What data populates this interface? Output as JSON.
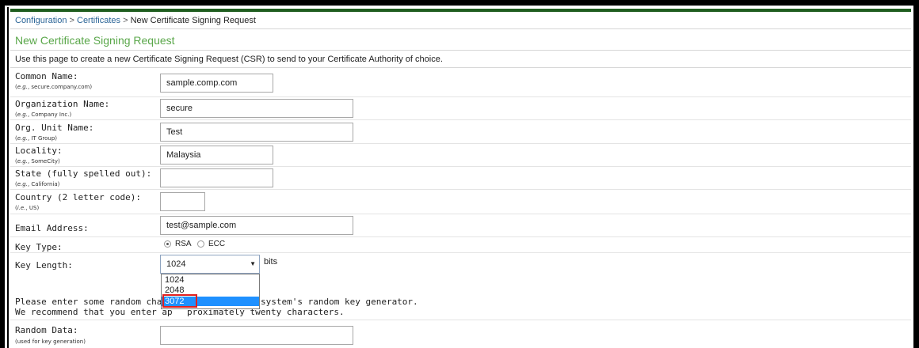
{
  "breadcrumb": {
    "items": [
      "Configuration",
      "Certificates"
    ],
    "separator": ">",
    "current": "New Certificate Signing Request"
  },
  "page": {
    "title": "New Certificate Signing Request",
    "description": "Use this page to create a new Certificate Signing Request (CSR) to send to your Certificate Authority of choice."
  },
  "fields": {
    "common_name": {
      "label": "Common Name:",
      "hint_prefix": "e.g.",
      "hint": ", secure.company.com)",
      "value": "sample.comp.com"
    },
    "organization": {
      "label": "Organization Name:",
      "hint_prefix": "e.g.",
      "hint": ", Company Inc.)",
      "value": "secure"
    },
    "org_unit": {
      "label": "Org. Unit Name:",
      "hint_prefix": "e.g.",
      "hint": ", IT Group)",
      "value": "Test"
    },
    "locality": {
      "label": "Locality:",
      "hint_prefix": "e.g.",
      "hint": ", SomeCity)",
      "value": "Malaysia"
    },
    "state": {
      "label": "State (fully spelled out):",
      "hint_prefix": "e.g.",
      "hint": ", California)",
      "value": ""
    },
    "country": {
      "label": "Country (2 letter code):",
      "hint_prefix": "i.e.",
      "hint": ", US)",
      "value": ""
    },
    "email": {
      "label": "Email Address:",
      "value": "test@sample.com"
    }
  },
  "key_type": {
    "label": "Key Type:",
    "options": [
      "RSA",
      "ECC"
    ],
    "selected": "RSA"
  },
  "key_length": {
    "label": "Key Length:",
    "value": "1024",
    "unit": "bits",
    "options": [
      "1024",
      "2048",
      "3072"
    ],
    "highlighted": "3072"
  },
  "random_note": {
    "line1_start": "Please enter some random chara",
    "line1_end": "system's random key generator.",
    "line2_start": "We recommend that you enter ap",
    "line2_end": "proximately twenty characters."
  },
  "random_data": {
    "label": "Random Data:",
    "hint": "(used for key generation)",
    "value": ""
  },
  "colors": {
    "title_green": "#5aa74a",
    "link_blue": "#2a6496",
    "highlight_red": "#e02020",
    "selected_blue": "#1e90ff"
  }
}
